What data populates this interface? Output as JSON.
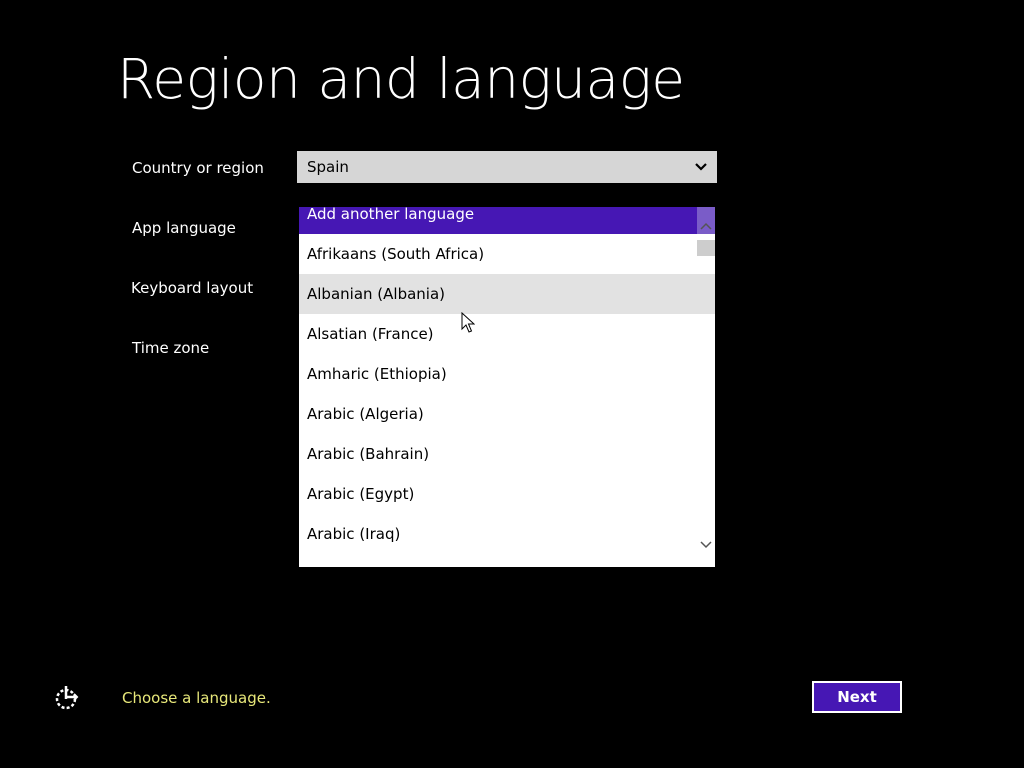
{
  "page": {
    "title": "Region and language"
  },
  "form": {
    "labels": {
      "country": "Country or region",
      "app_language": "App language",
      "keyboard_layout": "Keyboard layout",
      "time_zone": "Time zone"
    },
    "country_value": "Spain"
  },
  "dropdown": {
    "header": "Add another language",
    "items": [
      "Afrikaans (South Africa)",
      "Albanian (Albania)",
      "Alsatian (France)",
      "Amharic (Ethiopia)",
      "Arabic (Algeria)",
      "Arabic (Bahrain)",
      "Arabic (Egypt)",
      "Arabic (Iraq)"
    ],
    "hovered_item": "Albanian (Albania)"
  },
  "footer": {
    "status": "Choose a language.",
    "next_label": "Next",
    "ease_of_access_icon": "ease-of-access-icon"
  },
  "colors": {
    "background": "#000000",
    "accent": "#4617b4",
    "status_text": "#e8e87a",
    "field_bg": "#d6d6d6",
    "hover_bg": "#e2e2e2"
  }
}
